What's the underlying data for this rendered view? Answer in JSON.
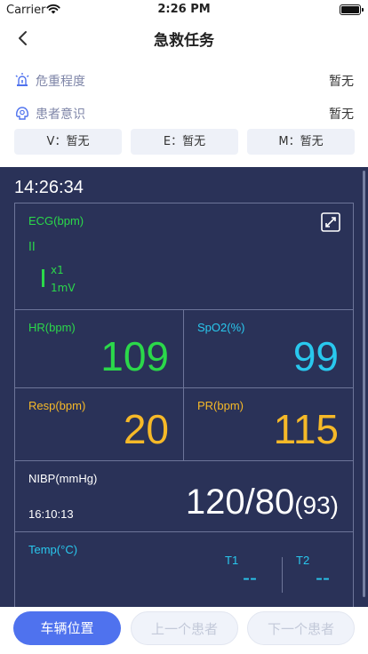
{
  "status_bar": {
    "carrier": "Carrier",
    "time": "2:26 PM"
  },
  "nav": {
    "title": "急救任务"
  },
  "severity": {
    "label": "危重程度",
    "value": "暂无",
    "icon": "alarm-icon"
  },
  "consciousness": {
    "label": "患者意识",
    "value": "暂无",
    "icon": "head-icon"
  },
  "gcs": {
    "v": "V：暂无",
    "e": "E：暂无",
    "m": "M：暂无"
  },
  "monitor": {
    "clock": "14:26:34",
    "ecg": {
      "label": "ECG(bpm)",
      "lead": "II",
      "gain": "x1",
      "scale": "1mV"
    },
    "hr": {
      "label": "HR(bpm)",
      "value": "109"
    },
    "spo2": {
      "label": "SpO2(%)",
      "value": "99"
    },
    "resp": {
      "label": "Resp(bpm)",
      "value": "20"
    },
    "pr": {
      "label": "PR(bpm)",
      "value": "115"
    },
    "nibp": {
      "label": "NIBP(mmHg)",
      "time": "16:10:13",
      "value": "120/80",
      "mean": "(93)"
    },
    "temp": {
      "label": "Temp(°C)",
      "t1_label": "T1",
      "t1_value": "--",
      "t2_label": "T2",
      "t2_value": "--"
    }
  },
  "footer": {
    "vehicle_location": "车辆位置",
    "prev_patient": "上一个患者",
    "next_patient": "下一个患者"
  },
  "colors": {
    "monitor_bg": "#2a3258",
    "green": "#2bd84a",
    "cyan": "#29c8ee",
    "amber": "#f6b928",
    "primary_button": "#4f72ee"
  }
}
